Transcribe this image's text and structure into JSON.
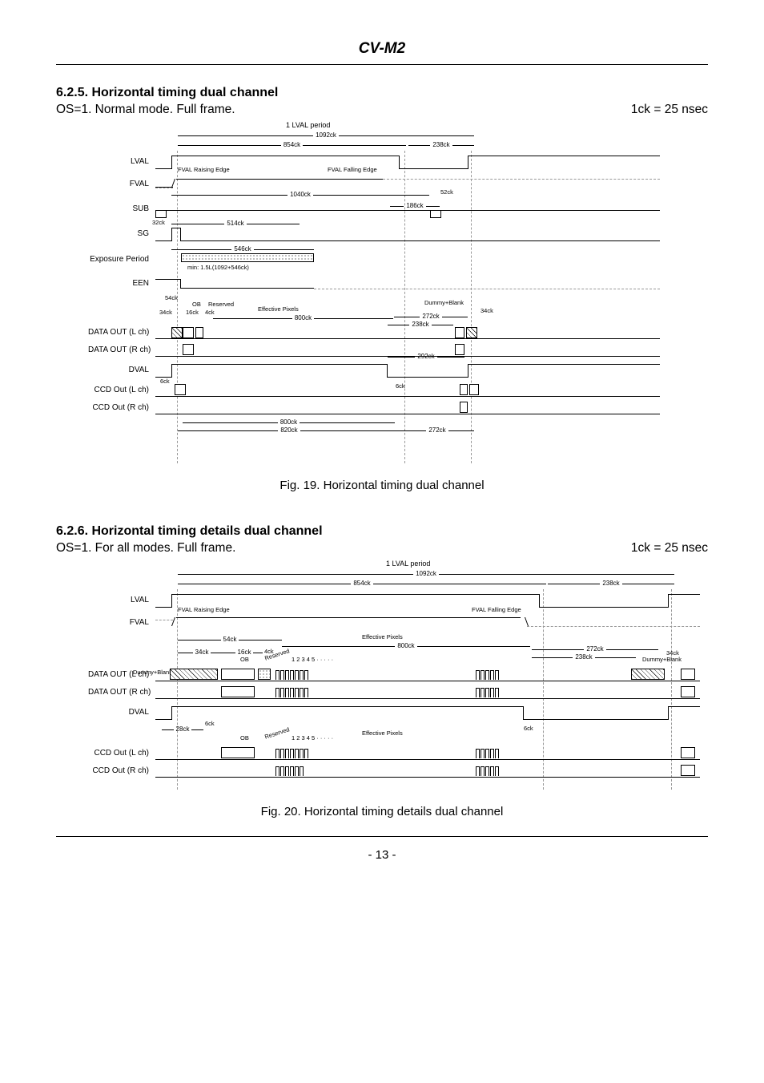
{
  "header": {
    "model": "CV-M2"
  },
  "section1": {
    "heading": "6.2.5. Horizontal timing dual channel",
    "mode": "OS=1. Normal mode. Full frame.",
    "clock": "1ck = 25 nsec",
    "caption": "Fig. 19. Horizontal timing dual channel",
    "signals": [
      "LVAL",
      "FVAL",
      "SUB",
      "SG",
      "Exposure Period",
      "EEN",
      "DATA OUT (L ch)",
      "DATA OUT (R ch)",
      "DVAL",
      "CCD Out (L ch)",
      "CCD Out (R ch)"
    ],
    "top_ann": {
      "period": "1 LVAL period",
      "t1092": "1092ck",
      "t854": "854ck",
      "t238": "238ck"
    },
    "labels": {
      "fval_rising": "FVAL Raising Edge",
      "fval_falling": "FVAL Falling Edge",
      "t1040": "1040ck",
      "t52": "52ck",
      "t186": "186ck",
      "t32": "32ck",
      "t514": "514ck",
      "t546": "546ck",
      "min": "min: 1.5L(1092+546ck)",
      "t54": "54ck",
      "ob": "OB",
      "reserved": "Reserved",
      "t16": "16ck",
      "t4": "4ck",
      "t34": "34ck",
      "eff": "Effective Pixels",
      "t800": "800ck",
      "dummy": "Dummy+Blank",
      "t272": "272ck",
      "t238b": "238ck",
      "t34b": "34ck",
      "t292": "292ck",
      "t6": "6ck",
      "t6b": "6ck",
      "t820": "820ck"
    }
  },
  "section2": {
    "heading": "6.2.6. Horizontal timing details dual channel",
    "mode": "OS=1. For all modes. Full frame.",
    "clock": "1ck = 25 nsec",
    "caption": "Fig. 20. Horizontal timing details dual channel",
    "signals": [
      "LVAL",
      "FVAL",
      "DATA OUT (L ch)",
      "DATA OUT (R ch)",
      "DVAL",
      "CCD Out (L ch)",
      "CCD Out (R ch)"
    ],
    "top_ann": {
      "period": "1 LVAL period",
      "t1092": "1092ck",
      "t854": "854ck",
      "t238": "238ck"
    },
    "labels": {
      "fval_rising": "FVAL Raising Edge",
      "fval_falling": "FVAL Falling Edge",
      "t54": "54ck",
      "t34": "34ck",
      "t16": "16ck",
      "t4": "4ck",
      "ob": "OB",
      "reserved": "Reserved",
      "nums": "1 2 3 4 5 · · · · ·",
      "eff": "Effective Pixels",
      "t800": "800ck",
      "t272": "272ck",
      "t238b": "238ck",
      "t34b": "34ck",
      "dummy": "Dummy+Blank",
      "t28": "28ck",
      "t6": "6ck",
      "t6b": "6ck"
    }
  },
  "footer": {
    "page": "- 13 -"
  }
}
